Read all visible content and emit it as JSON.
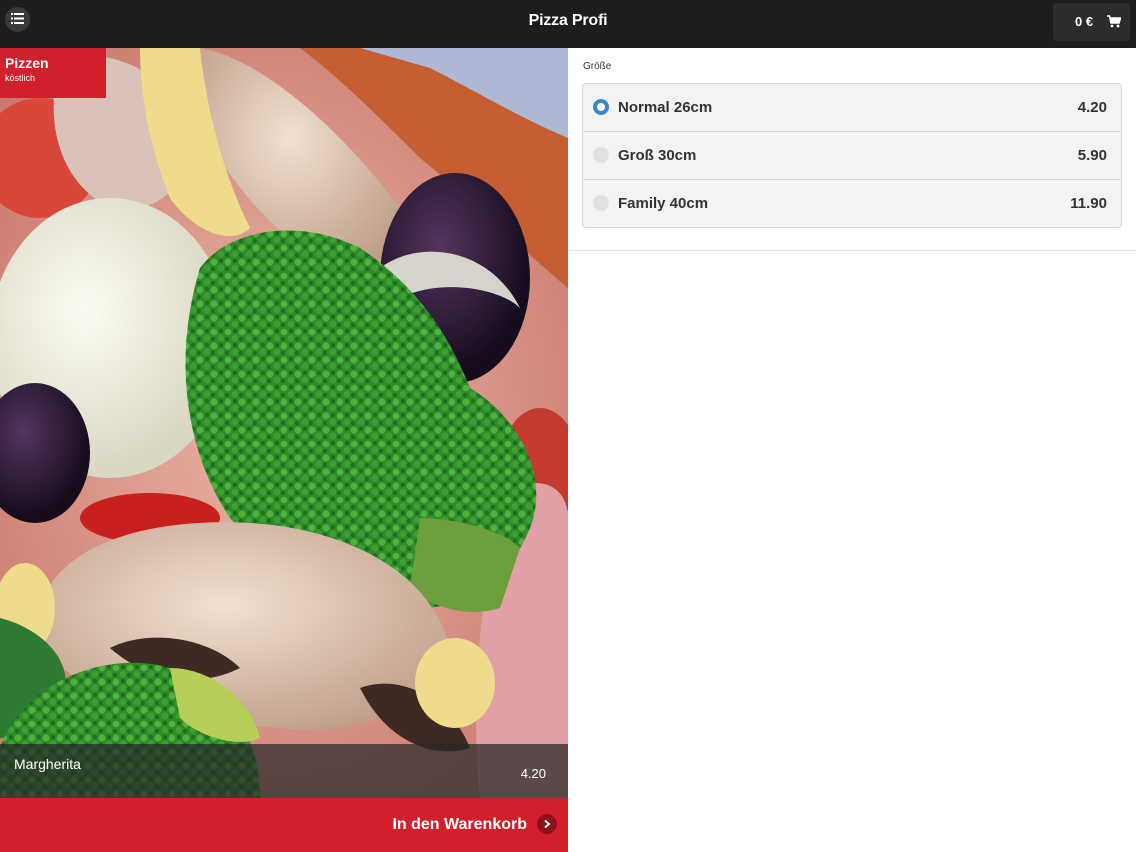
{
  "header": {
    "title": "Pizza Profi",
    "cart_total": "0 €"
  },
  "icons": {
    "menu": "list-icon",
    "cart": "shopping-cart-icon",
    "add": "chevron-right-icon"
  },
  "category": {
    "title": "Pizzen",
    "subtitle": "köstlich"
  },
  "product": {
    "name": "Margherita",
    "price": "4.20"
  },
  "add_to_cart_label": "In den Warenkorb",
  "size_section": {
    "label": "Größe",
    "options": [
      {
        "label": "Normal 26cm",
        "price": "4.20",
        "selected": true
      },
      {
        "label": "Groß 30cm",
        "price": "5.90",
        "selected": false
      },
      {
        "label": "Family 40cm",
        "price": "11.90",
        "selected": false
      }
    ]
  },
  "colors": {
    "accent_red": "#d0202c",
    "topbar": "#1d1d1f",
    "radio_selected": "#3a87c8"
  }
}
